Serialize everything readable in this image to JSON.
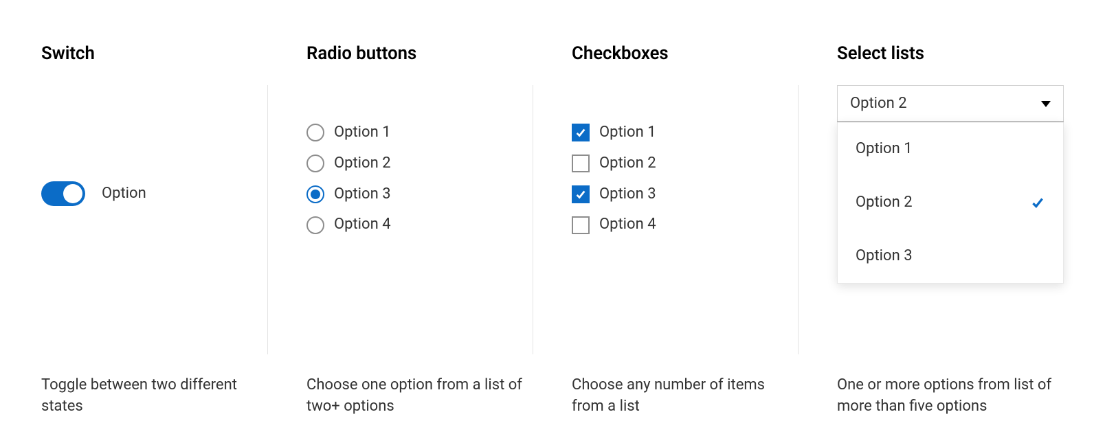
{
  "colors": {
    "accent": "#0b6cc7"
  },
  "switch": {
    "heading": "Switch",
    "label": "Option",
    "on": true,
    "desc": "Toggle between two different states"
  },
  "radio": {
    "heading": "Radio buttons",
    "options": [
      {
        "label": "Option 1",
        "selected": false
      },
      {
        "label": "Option 2",
        "selected": false
      },
      {
        "label": "Option 3",
        "selected": true
      },
      {
        "label": "Option 4",
        "selected": false
      }
    ],
    "desc": "Choose one option from a list of two+ options"
  },
  "checkbox": {
    "heading": "Checkboxes",
    "options": [
      {
        "label": "Option 1",
        "checked": true
      },
      {
        "label": "Option 2",
        "checked": false
      },
      {
        "label": "Option 3",
        "checked": true
      },
      {
        "label": "Option 4",
        "checked": false
      }
    ],
    "desc": "Choose any number of items from a list"
  },
  "select": {
    "heading": "Select lists",
    "selected_label": "Option 2",
    "options": [
      {
        "label": "Option 1",
        "selected": false
      },
      {
        "label": "Option 2",
        "selected": true
      },
      {
        "label": "Option 3",
        "selected": false
      }
    ],
    "desc": "One or more options from list of more than five options"
  }
}
